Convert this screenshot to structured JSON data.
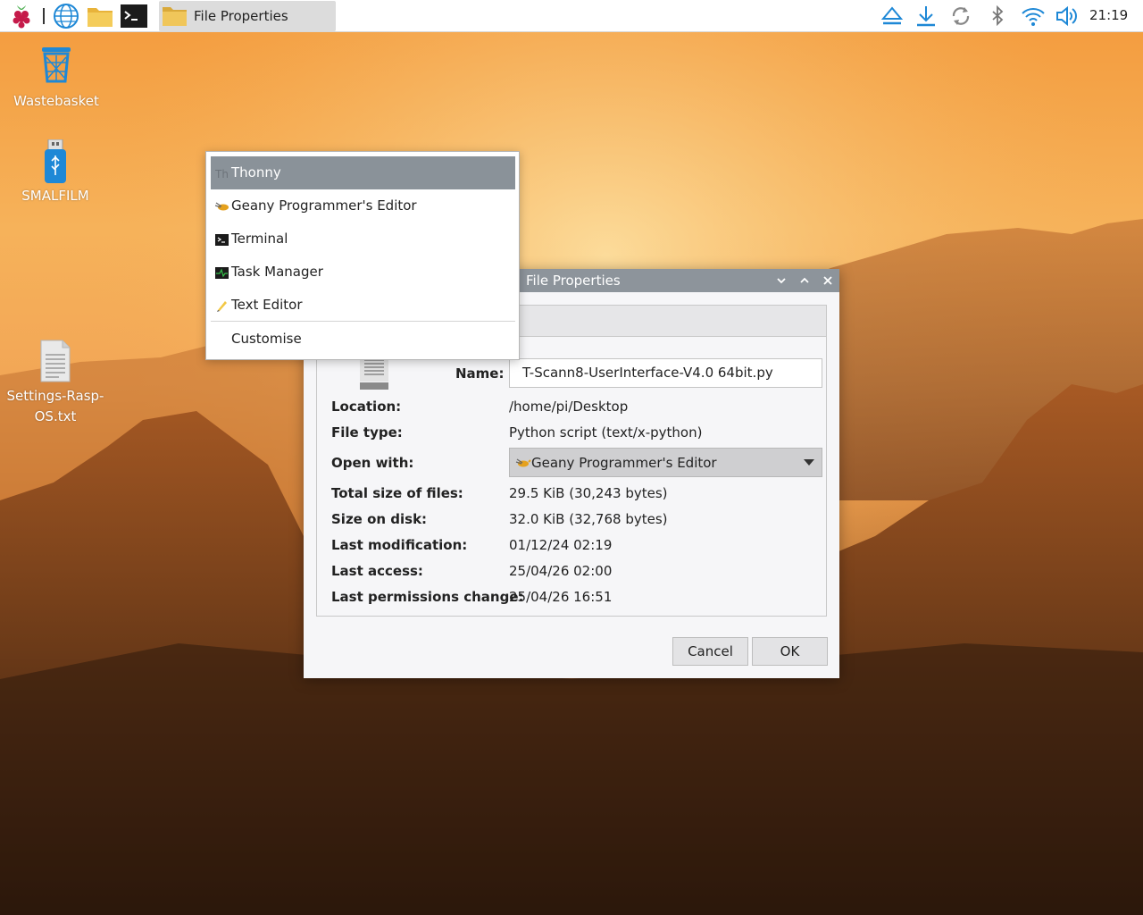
{
  "taskbar": {
    "task_label": "File Properties",
    "clock": "21:19"
  },
  "desktop": {
    "icons": [
      {
        "label": "Wastebasket"
      },
      {
        "label": "SMALFILM"
      },
      {
        "label": "Settings-Rasp-OS.txt"
      }
    ]
  },
  "dialog": {
    "title": "File Properties",
    "name_label": "Name:",
    "name_value": "T-Scann8-UserInterface-V4.0 64bit.py",
    "rows": [
      {
        "label": "Location:",
        "value": "/home/pi/Desktop"
      },
      {
        "label": "File type:",
        "value": "Python script (text/x-python)"
      },
      {
        "label": "Open with:",
        "value": "Geany Programmer's Editor"
      },
      {
        "label": "Total size of files:",
        "value": "29.5 KiB (30,243 bytes)"
      },
      {
        "label": "Size on disk:",
        "value": "32.0 KiB (32,768 bytes)"
      },
      {
        "label": "Last modification:",
        "value": "01/12/24 02:19"
      },
      {
        "label": "Last access:",
        "value": "25/04/26 02:00"
      },
      {
        "label": "Last permissions change:",
        "value": "25/04/26 16:51"
      }
    ],
    "cancel_label": "Cancel",
    "ok_label": "OK"
  },
  "menu": {
    "items": [
      {
        "label": "Thonny",
        "icon": "thonny-icon",
        "selected": true
      },
      {
        "label": "Geany Programmer's Editor",
        "icon": "geany-icon"
      },
      {
        "label": "Terminal",
        "icon": "terminal-icon"
      },
      {
        "label": "Task Manager",
        "icon": "task-manager-icon"
      },
      {
        "label": "Text Editor",
        "icon": "text-editor-icon"
      },
      {
        "label": "Customise",
        "icon": ""
      }
    ]
  },
  "colors": {
    "menu_highlight": "#8a9299",
    "titlebar": "#8d949b",
    "accent_blue": "#1e88d6"
  }
}
